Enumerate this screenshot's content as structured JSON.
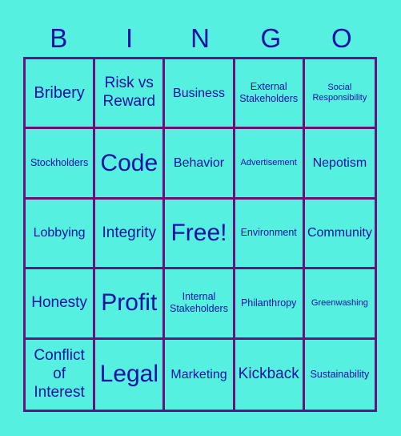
{
  "header": [
    "B",
    "I",
    "N",
    "G",
    "O"
  ],
  "colors": {
    "background": "#55f0df",
    "grid": "#6b0f7c",
    "text": "#1111a8"
  },
  "cells": [
    [
      "Bribery",
      "Risk vs Reward",
      "Business",
      "External Stakeholders",
      "Social Responsibility"
    ],
    [
      "Stockholders",
      "Code",
      "Behavior",
      "Advertisement",
      "Nepotism"
    ],
    [
      "Lobbying",
      "Integrity",
      "Free!",
      "Environment",
      "Community"
    ],
    [
      "Honesty",
      "Profit",
      "Internal Stakeholders",
      "Philanthropy",
      "Greenwashing"
    ],
    [
      "Conflict of Interest",
      "Legal",
      "Marketing",
      "Kickback",
      "Sustainability"
    ]
  ]
}
